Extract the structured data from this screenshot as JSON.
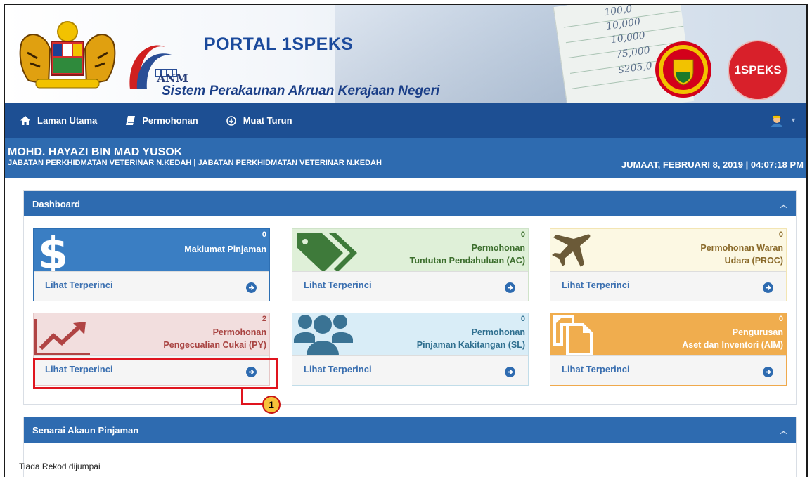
{
  "header": {
    "portal_title": "PORTAL 1SPEKS",
    "subtitle": "Sistem Perakaunan Akruan Kerajaan Negeri",
    "anm_label": "ANM",
    "speks_logo_text": "1SPEKS",
    "sheet_numbers": [
      "100,0",
      "10,000",
      "10,000",
      "75,000",
      "$205,0"
    ]
  },
  "nav": {
    "items": [
      {
        "label": "Laman Utama",
        "icon": "home-icon"
      },
      {
        "label": "Permohonan",
        "icon": "book-icon"
      },
      {
        "label": "Muat Turun",
        "icon": "download-icon"
      }
    ],
    "user_icon": "user-avatar-icon"
  },
  "userbar": {
    "name": "MOHD. HAYAZI BIN MAD YUSOK",
    "department": "JABATAN PERKHIDMATAN VETERINAR N.KEDAH | JABATAN PERKHIDMATAN VETERINAR N.KEDAH",
    "datetime": "JUMAAT, FEBRUARI 8, 2019 | 04:07:18 PM"
  },
  "dashboard": {
    "title": "Dashboard",
    "detail_label": "Lihat Terperinci",
    "cards": [
      {
        "count": "0",
        "line1": "",
        "line2": "Maklumat Pinjaman",
        "icon": "dollar-icon",
        "color": "#3a7ec3"
      },
      {
        "count": "0",
        "line1": "Permohonan",
        "line2": "Tuntutan Pendahuluan (AC)",
        "icon": "tags-icon",
        "color": "#dff0d8"
      },
      {
        "count": "0",
        "line1": "Permohonan Waran",
        "line2": "Udara (PROC)",
        "icon": "plane-icon",
        "color": "#fcf8e3"
      },
      {
        "count": "2",
        "line1": "Permohonan",
        "line2": "Pengecualian Cukai (PY)",
        "icon": "line-chart-icon",
        "color": "#f2dede"
      },
      {
        "count": "0",
        "line1": "Permohonan",
        "line2": "Pinjaman Kakitangan (SL)",
        "icon": "users-icon",
        "color": "#d9edf7"
      },
      {
        "count": "0",
        "line1": "Pengurusan",
        "line2": "Aset dan Inventori (AIM)",
        "icon": "copy-icon",
        "color": "#f0ad4e"
      }
    ]
  },
  "annotation": {
    "callout_number": "1"
  },
  "loans": {
    "title": "Senarai Akaun Pinjaman",
    "empty_text": "Tiada Rekod dijumpai"
  }
}
